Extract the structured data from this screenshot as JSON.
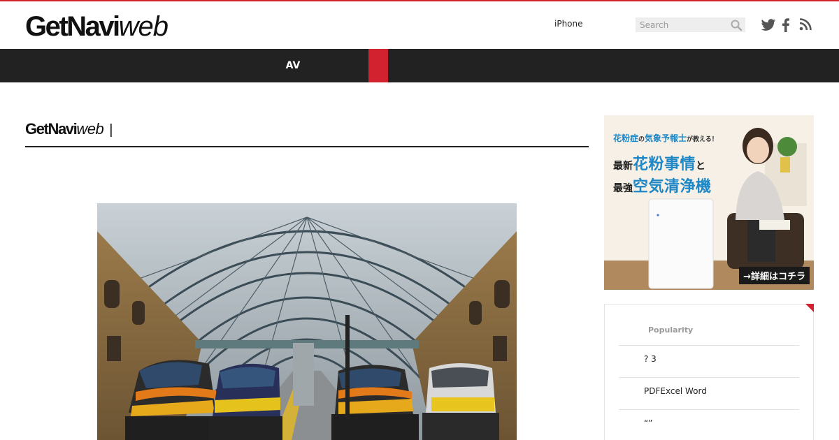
{
  "header": {
    "logo_bold": "GetNavi",
    "logo_light": "web",
    "nav_link": "iPhone",
    "search_placeholder": "Search",
    "social_icons": [
      "twitter-icon",
      "facebook-icon",
      "rss-icon"
    ]
  },
  "nav": {
    "items": [
      {
        "label": "AV"
      }
    ],
    "accent_color": "#d3222f"
  },
  "section": {
    "logo_bold": "GetNavi",
    "logo_light": "web",
    "separator": "|"
  },
  "ad": {
    "line1_a": "花粉症",
    "line1_b": "の",
    "line1_c": "気象予報士",
    "line1_d": "が教える！",
    "row1_lead": "最新",
    "row1_big": "花粉事情",
    "row1_tail": "と",
    "row2_lead": "最強",
    "row2_big": "空気清浄機",
    "cta": "→詳細はコチラ"
  },
  "popular": {
    "title": "Popularity",
    "items": [
      {
        "label": "? 3"
      },
      {
        "label": "PDFExcel Word"
      },
      {
        "label": "“”"
      }
    ]
  },
  "colors": {
    "accent": "#d3222f",
    "nav_bg": "#222222"
  }
}
